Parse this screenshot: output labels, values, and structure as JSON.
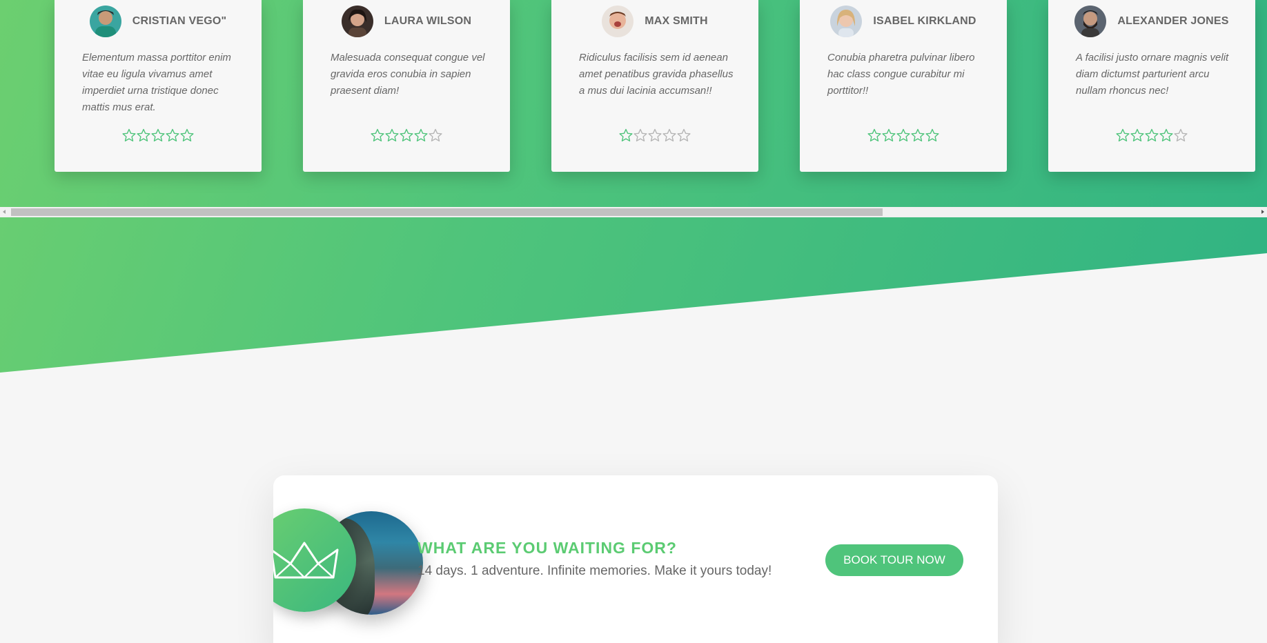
{
  "reviews": [
    {
      "name": "CRISTIAN VEGO\"",
      "quote": "Elementum massa porttitor enim vitae eu ligula vivamus amet imperdiet urna tristique donec mattis mus erat.",
      "rating": 5
    },
    {
      "name": "LAURA WILSON",
      "quote": "Malesuada consequat congue vel gravida eros conubia in sapien praesent diam!",
      "rating": 4
    },
    {
      "name": "MAX SMITH",
      "quote": "Ridiculus facilisis sem id aenean amet penatibus gravida phasellus a mus dui lacinia accumsan!!",
      "rating": 1
    },
    {
      "name": "ISABEL KIRKLAND",
      "quote": "Conubia pharetra pulvinar libero hac class congue curabitur mi porttitor!!",
      "rating": 5
    },
    {
      "name": "ALEXANDER JONES",
      "quote": "A facilisi justo ornare magnis velit diam dictumst parturient arcu nullam rhoncus nec!",
      "rating": 4
    }
  ],
  "star_max": 5,
  "colors": {
    "accent": "#4fc47b",
    "star_filled": "#4fc47b",
    "star_empty": "#b5b5b5"
  },
  "scroll": {
    "position_fraction": 0.0,
    "visible_fraction": 0.7
  },
  "cta": {
    "title": "WHAT ARE YOU WAITING FOR?",
    "text": "14 days. 1 adventure. Infinite memories. Make it yours today!",
    "button_label": "BOOK TOUR NOW"
  }
}
